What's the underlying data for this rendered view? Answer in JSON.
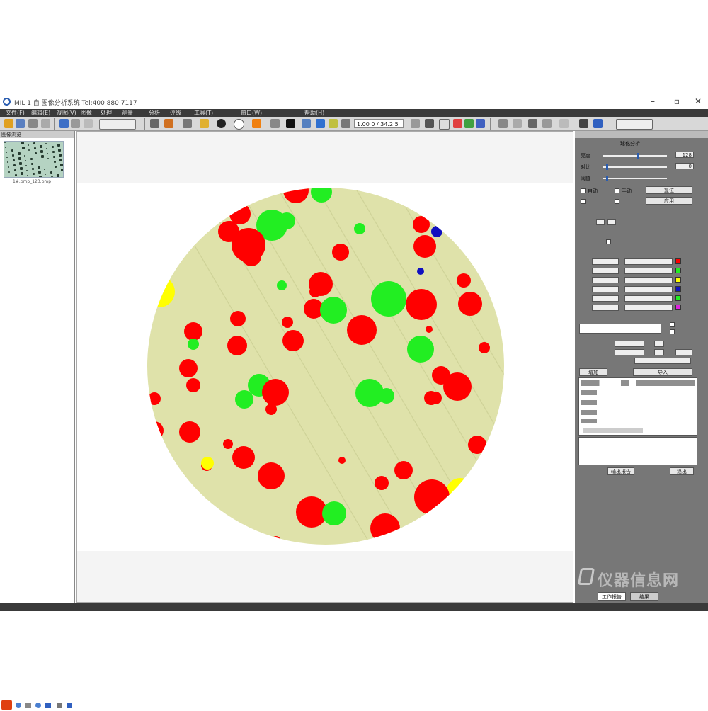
{
  "window": {
    "title": "MIL 1 自 图像分析系统 Tel:400 880 7117",
    "controls": {
      "minimize": "–",
      "maximize": "▫",
      "close": "✕"
    }
  },
  "menu": [
    "文件(F)",
    "编辑(E)",
    "视图(V)",
    "图像",
    "处理",
    "测量",
    "分析",
    "评级",
    "工具(T)",
    "窗口(W)",
    "帮助(H)"
  ],
  "toolbar": {
    "zoom_value": "1.00 0 / 34.2 5"
  },
  "left_panel": {
    "header": "图像浏览",
    "thumbnail_label": "1#.bmp_123.bmp"
  },
  "right_panel": {
    "section_title": "球化分析",
    "sliders": [
      {
        "label": "亮度",
        "value": "128",
        "level": 0.55
      },
      {
        "label": "对比",
        "value": "0",
        "level": 0.05
      },
      {
        "label": "阈值",
        "value": "",
        "level": 0.05
      }
    ],
    "options": [
      {
        "label": "自动",
        "value": ""
      },
      {
        "label": "手动",
        "value": ""
      }
    ],
    "buttons": {
      "reset": "复位",
      "apply": "应用",
      "add": "增加",
      "import": "导入",
      "export": "输出报告",
      "exit": "退出"
    },
    "tabs": [
      "工作报告",
      "结果"
    ]
  },
  "watermark": {
    "text": "仪器信息网"
  },
  "colors": {
    "red": "#ff0000",
    "green": "#22ee22",
    "yellow": "#ffff00",
    "blue": "#1010c0",
    "magenta": "#e020e0",
    "matrix": "#dfe2aa"
  }
}
